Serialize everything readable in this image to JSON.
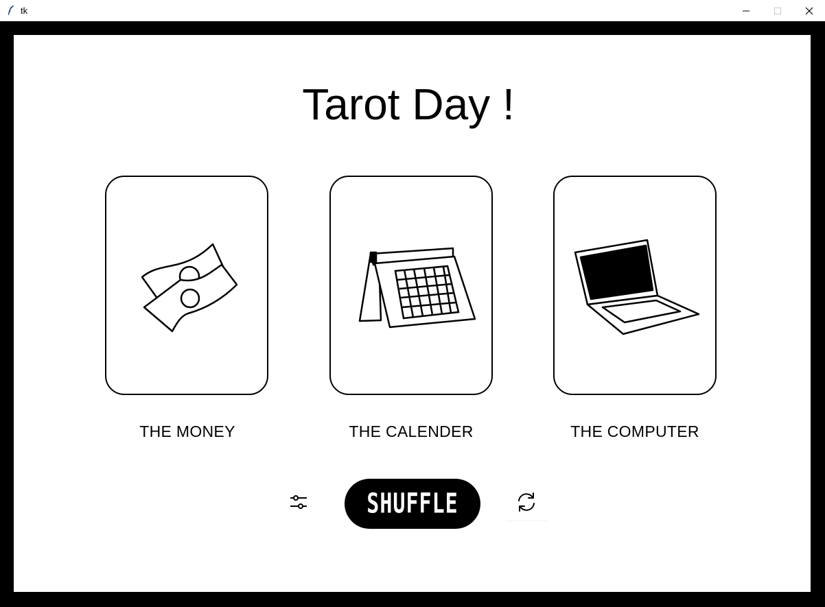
{
  "window": {
    "title": "tk",
    "minimize_glyph": "–",
    "maximize_glyph": "□",
    "close_glyph": "✕"
  },
  "main": {
    "heading": "Tarot Day !",
    "cards": [
      {
        "label": "THE MONEY",
        "icon": "money-icon"
      },
      {
        "label": "THE CALENDER",
        "icon": "calendar-icon"
      },
      {
        "label": "THE COMPUTER",
        "icon": "laptop-icon"
      }
    ]
  },
  "controls": {
    "settings_icon": "sliders-icon",
    "shuffle_label": "SHUFFLE",
    "refresh_icon": "refresh-icon"
  },
  "colors": {
    "frame": "#000000",
    "background": "#ffffff",
    "button": "#000000",
    "button_text": "#ffffff"
  }
}
